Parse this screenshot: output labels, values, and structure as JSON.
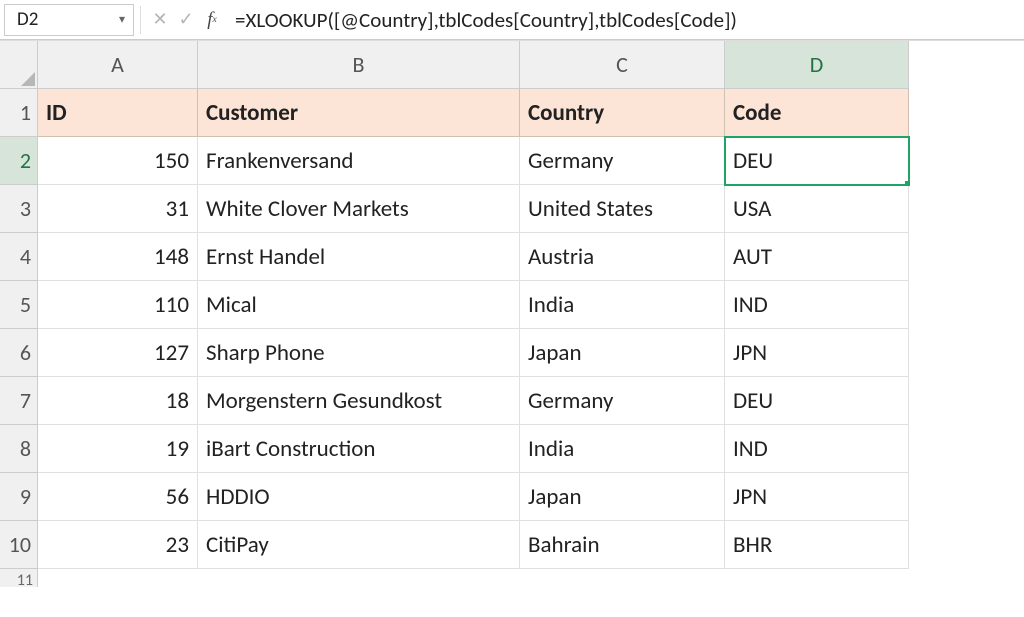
{
  "formula_bar": {
    "cell_ref": "D2",
    "formula": "=XLOOKUP([@Country],tblCodes[Country],tblCodes[Code])"
  },
  "columns": [
    "A",
    "B",
    "C",
    "D"
  ],
  "selected_col": "D",
  "selected_row": 2,
  "row_headers": [
    1,
    2,
    3,
    4,
    5,
    6,
    7,
    8,
    9,
    10
  ],
  "extra_row_stub": "11",
  "table": {
    "headers": [
      "ID",
      "Customer",
      "Country",
      "Code"
    ],
    "rows": [
      {
        "id": 150,
        "customer": "Frankenversand",
        "country": "Germany",
        "code": "DEU"
      },
      {
        "id": 31,
        "customer": "White Clover Markets",
        "country": "United States",
        "code": "USA"
      },
      {
        "id": 148,
        "customer": "Ernst Handel",
        "country": "Austria",
        "code": "AUT"
      },
      {
        "id": 110,
        "customer": "Mical",
        "country": "India",
        "code": "IND"
      },
      {
        "id": 127,
        "customer": "Sharp Phone",
        "country": "Japan",
        "code": "JPN"
      },
      {
        "id": 18,
        "customer": "Morgenstern Gesundkost",
        "country": "Germany",
        "code": "DEU"
      },
      {
        "id": 19,
        "customer": "iBart Construction",
        "country": "India",
        "code": "IND"
      },
      {
        "id": 56,
        "customer": "HDDIO",
        "country": "Japan",
        "code": "JPN"
      },
      {
        "id": 23,
        "customer": "CitiPay",
        "country": "Bahrain",
        "code": "BHR"
      }
    ]
  }
}
